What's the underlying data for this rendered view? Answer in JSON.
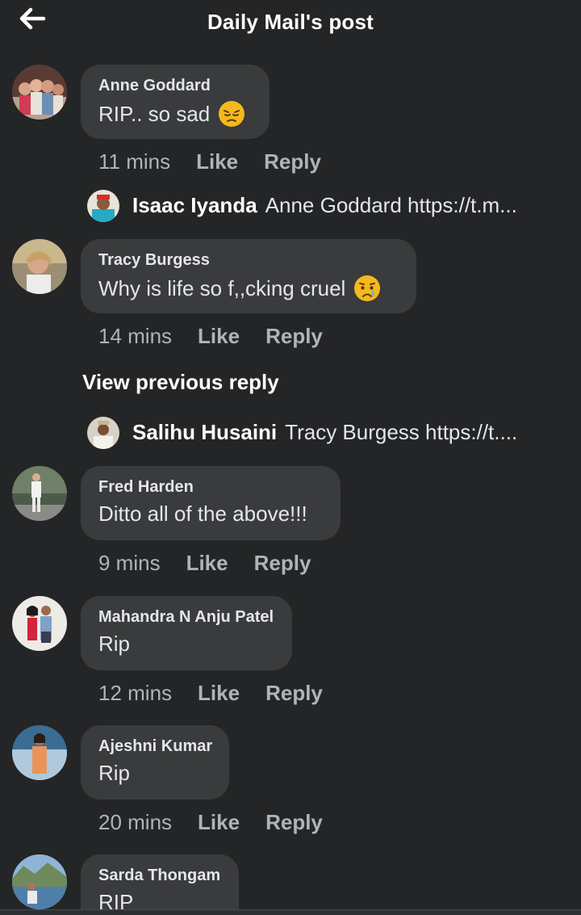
{
  "header": {
    "title": "Daily Mail's post",
    "back_icon": "arrow-left-icon"
  },
  "colors": {
    "background": "#242526",
    "bubble": "#3a3b3c",
    "secondary_text": "#b0b3b8",
    "primary_text": "#e4e6eb"
  },
  "comments": [
    {
      "author": "Anne Goddard",
      "text": "RIP.. so sad",
      "emoji": "pensive-face",
      "time": "11 mins",
      "like": "Like",
      "reply": "Reply",
      "reply_preview": {
        "author": "Isaac Iyanda",
        "text": "Anne Goddard https://t.m..."
      }
    },
    {
      "author": "Tracy Burgess",
      "text": "Why is life so f,,cking cruel",
      "emoji": "crying-face",
      "time": "14 mins",
      "like": "Like",
      "reply": "Reply",
      "view_previous": "View previous reply",
      "reply_preview": {
        "author": "Salihu Husaini",
        "text": "Tracy Burgess https://t...."
      }
    },
    {
      "author": "Fred Harden",
      "text": "Ditto all of the above!!!",
      "time": "9 mins",
      "like": "Like",
      "reply": "Reply"
    },
    {
      "author": "Mahandra N Anju Patel",
      "text": "Rip",
      "time": "12 mins",
      "like": "Like",
      "reply": "Reply"
    },
    {
      "author": "Ajeshni Kumar",
      "text": "Rip",
      "time": "20 mins",
      "like": "Like",
      "reply": "Reply"
    },
    {
      "author": "Sarda Thongam",
      "text": "RIP"
    }
  ]
}
